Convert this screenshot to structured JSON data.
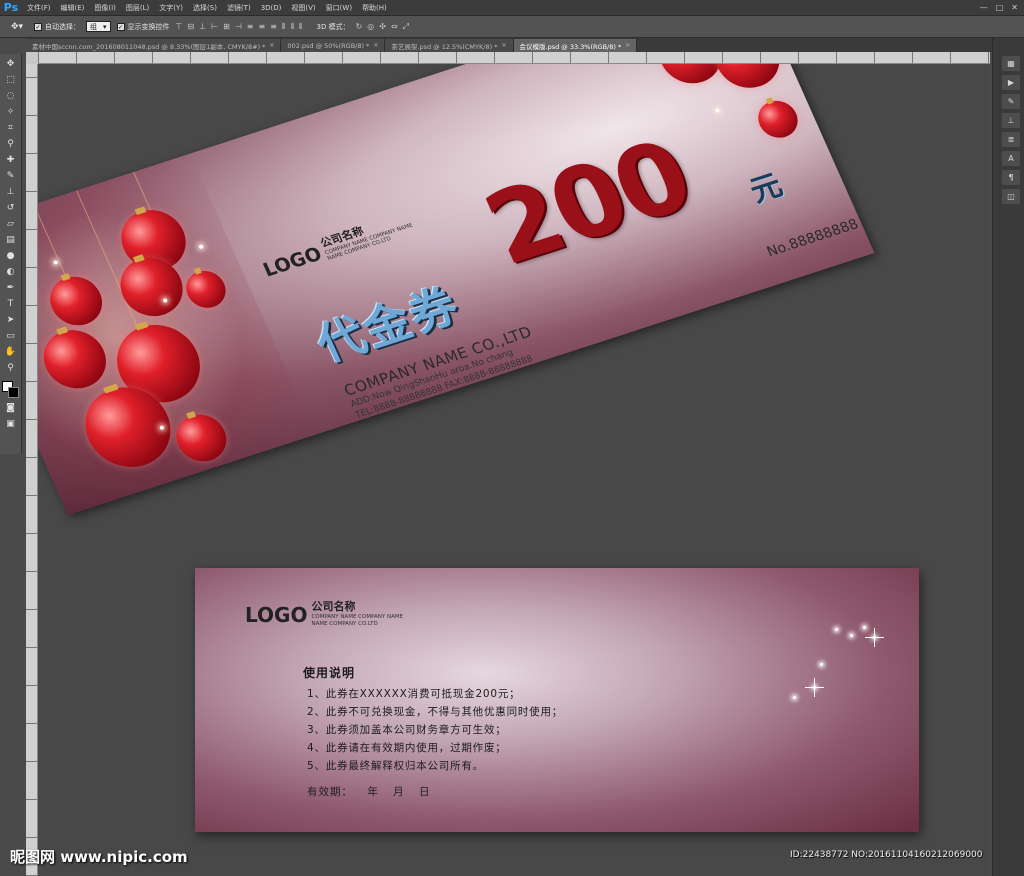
{
  "app": {
    "logo": "Ps"
  },
  "menu": [
    "文件(F)",
    "编辑(E)",
    "图像(I)",
    "图层(L)",
    "文字(Y)",
    "选择(S)",
    "滤镜(T)",
    "3D(D)",
    "视图(V)",
    "窗口(W)",
    "帮助(H)"
  ],
  "window_controls": [
    "—",
    "□",
    "✕"
  ],
  "options": {
    "auto_select_label": "自动选择：",
    "auto_select_value": "组",
    "show_transform_label": "显示变换控件",
    "mode_3d_label": "3D 模式："
  },
  "tabs": [
    {
      "label": "素材中国sccnn.com_20160801104​8.psd @ 8.33%(图层1副本, CMYK/8#) *",
      "active": false
    },
    {
      "label": "002.psd @ 50%(RGB/8) *",
      "active": false
    },
    {
      "label": "茶艺展架.psd @ 12.5%(CMYK/8) *",
      "active": false
    },
    {
      "label": "会议模版.psd @ 33.3%(RGB/8) *",
      "active": true
    }
  ],
  "tools": [
    "move-icon",
    "marquee-icon",
    "lasso-icon",
    "magic-wand-icon",
    "crop-icon",
    "eyedropper-icon",
    "healing-icon",
    "brush-icon",
    "stamp-icon",
    "history-brush-icon",
    "eraser-icon",
    "gradient-icon",
    "blur-icon",
    "dodge-icon",
    "pen-icon",
    "type-icon",
    "path-select-icon",
    "shape-icon",
    "hand-icon",
    "zoom-icon"
  ],
  "right_panel_icons": [
    "layers-icon",
    "play-icon",
    "brush-panel-icon",
    "clone-panel-icon",
    "properties-icon",
    "character-icon",
    "paragraph-icon",
    "cube-icon"
  ],
  "voucher_front": {
    "logo": "LOGO",
    "company_cn": "公司名称",
    "company_sub_1": "COMPANY NAME COMPANY NAME",
    "company_sub_2": "NAME COMPANY CO.LTD",
    "title": "代金券",
    "amount": "200",
    "currency": "元",
    "number": "No.88888888",
    "company_en": "COMPANY NAME CO.,LTD",
    "address": "ADD:Now QingShanHu aroa.No chang",
    "tel_fax": "TEL:8888-88888888  FAX:8888-88888888"
  },
  "voucher_back": {
    "logo": "LOGO",
    "company_cn": "公司名称",
    "company_sub_1": "COMPANY NAME COMPANY NAME",
    "company_sub_2": "NAME COMPANY CO.LTD",
    "heading": "使用说明",
    "rules": [
      "1、此券在XXXXXX消费可抵现金200元；",
      "2、此券不可兑换现金，不得与其他优惠同时使用；",
      "3、此券须加盖本公司财务章方可生效；",
      "4、此券请在有效期内使用，过期作废；",
      "5、此券最终解释权归本公司所有。"
    ],
    "valid_label": "有效期：",
    "valid_units": "年  月  日"
  },
  "watermark": {
    "left": "昵图网 www.nipic.com",
    "right": "ID:22438772 NO:20161104160212069000"
  }
}
